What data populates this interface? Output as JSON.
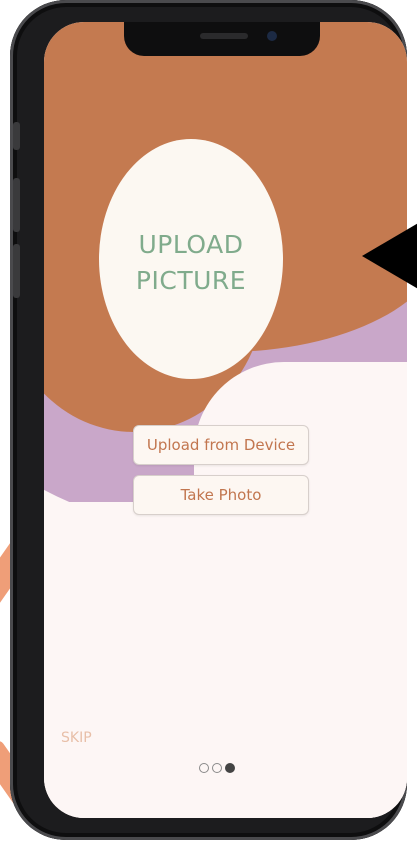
{
  "upload_circle": {
    "line1": "UPLOAD",
    "line2": "PICTURE"
  },
  "buttons": {
    "upload_device_label": "Upload from Device",
    "take_photo_label": "Take Photo"
  },
  "skip_label": "SKIP",
  "pager": {
    "total_pages": 3,
    "current_page": 3
  },
  "colors": {
    "terracotta": "#c47a50",
    "lilac": "#c9a7c9",
    "cream": "#fcf8f2",
    "sage_text": "#80ab8c",
    "button_text": "#c2764f"
  }
}
